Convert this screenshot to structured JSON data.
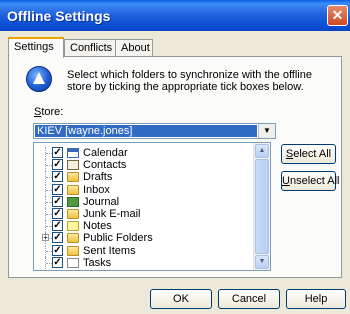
{
  "window": {
    "title": "Offline Settings",
    "close_label": "✕"
  },
  "tabs": [
    {
      "label": "Settings",
      "active": true
    },
    {
      "label": "Conflicts",
      "active": false
    },
    {
      "label": "About",
      "active": false
    }
  ],
  "description": "Select which folders to synchronize with the offline store by ticking the appropriate tick boxes below.",
  "store": {
    "label": "Store:",
    "value": "KIEV [wayne.jones]"
  },
  "folders": [
    {
      "label": "Calendar",
      "icon": "calendar-icon",
      "checked": true
    },
    {
      "label": "Contacts",
      "icon": "contacts-icon",
      "checked": true
    },
    {
      "label": "Drafts",
      "icon": "folder-icon",
      "checked": true
    },
    {
      "label": "Inbox",
      "icon": "folder-icon",
      "checked": true
    },
    {
      "label": "Journal",
      "icon": "journal-icon",
      "checked": true
    },
    {
      "label": "Junk E-mail",
      "icon": "folder-icon",
      "checked": true
    },
    {
      "label": "Notes",
      "icon": "notes-icon",
      "checked": true
    },
    {
      "label": "Public Folders",
      "icon": "folder-icon",
      "checked": true,
      "expander": "+"
    },
    {
      "label": "Sent Items",
      "icon": "folder-icon",
      "checked": true
    },
    {
      "label": "Tasks",
      "icon": "tasks-icon",
      "checked": true
    }
  ],
  "side_buttons": {
    "select_all": "Select All",
    "unselect_all": "Unselect All"
  },
  "footer": {
    "ok": "OK",
    "cancel": "Cancel",
    "help": "Help"
  },
  "colors": {
    "titlebar": "#0a4fd4",
    "selection": "#316ac5",
    "dialog_bg": "#ece9d8"
  }
}
